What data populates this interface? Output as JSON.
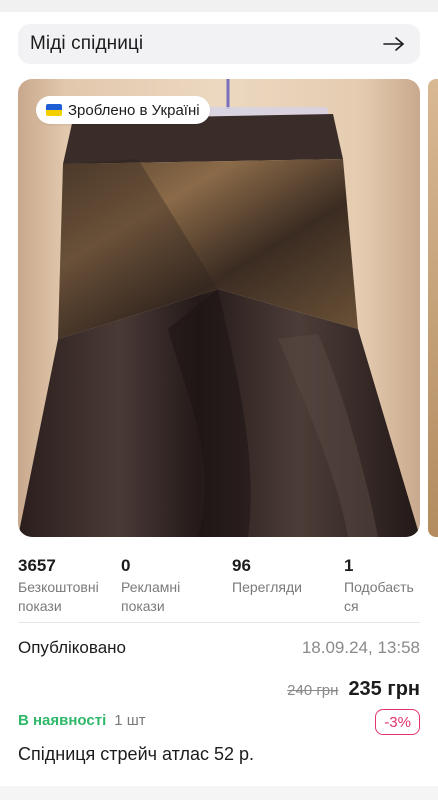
{
  "category": {
    "label": "Міді спідниці",
    "icon": "arrow-right-icon"
  },
  "badge": {
    "label": "Зроблено в Україні",
    "icon": "ukraine-flag-icon"
  },
  "photo": {
    "description_icon": "skirt-photo"
  },
  "stats": [
    {
      "value": "3657",
      "label": "Безкоштовні покази"
    },
    {
      "value": "0",
      "label": "Рекламні покази"
    },
    {
      "value": "96",
      "label": "Перегляди"
    },
    {
      "value": "1",
      "label": "Подобається"
    }
  ],
  "published": {
    "label": "Опубліковано",
    "date": "18.09.24, 13:58"
  },
  "price": {
    "old": "240 грн",
    "current": "235 грн",
    "discount": "-3%"
  },
  "stock": {
    "status": "В наявності",
    "quantity": "1 шт"
  },
  "product": {
    "title": "Спідниця стрейч атлас 52 р."
  },
  "colors": {
    "in_stock": "#2fb86a",
    "discount": "#e2336b",
    "muted": "#8a8a8a"
  }
}
